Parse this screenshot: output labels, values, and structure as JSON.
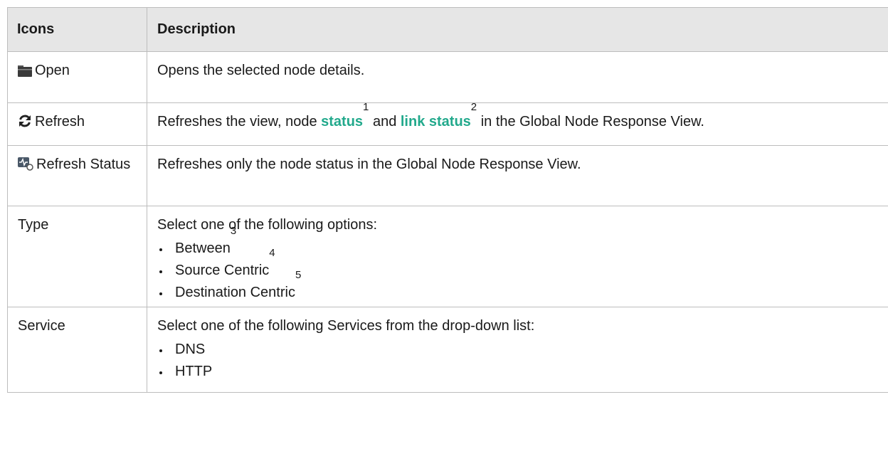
{
  "table": {
    "headers": [
      "Icons",
      "Description"
    ],
    "rows": [
      {
        "icon": "open-folder-icon",
        "label": "Open",
        "text": "Opens the selected node details."
      },
      {
        "icon": "refresh-icon",
        "label": "Refresh",
        "text_before": "Refreshes the view, node ",
        "link1": "status",
        "sup1": "1",
        "text_mid": " and ",
        "link2": "link status",
        "sup2": "2",
        "text_after": " in the Global Node Response View."
      },
      {
        "icon": "refresh-status-icon",
        "label": "Refresh Status",
        "text": "Refreshes only the node status in the Global Node Response View."
      },
      {
        "label": "Type",
        "text": "Select one of the following options:",
        "options": [
          {
            "label": "Between",
            "sup": "3"
          },
          {
            "label": "Source Centric",
            "sup": "4"
          },
          {
            "label": "Destination Centric",
            "sup": "5"
          }
        ]
      },
      {
        "label": "Service",
        "text": "Select one of the following Services from the drop-down list:",
        "options": [
          {
            "label": "DNS"
          },
          {
            "label": "HTTP"
          }
        ]
      }
    ]
  },
  "colors": {
    "header_bg": "#e6e6e6",
    "link": "#22a98c",
    "border": "#bdbdbd"
  }
}
